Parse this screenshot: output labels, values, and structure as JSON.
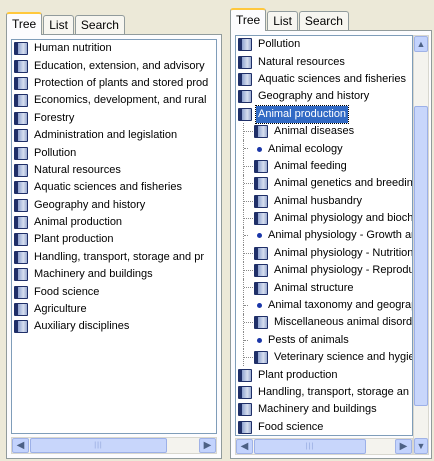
{
  "tabs": [
    "Tree",
    "List",
    "Search"
  ],
  "left_tree": [
    "Human nutrition",
    "Education, extension, and advisory",
    "Protection of plants and stored prod",
    "Economics, development, and rural",
    "Forestry",
    "Administration and legislation",
    "Pollution",
    "Natural resources",
    "Aquatic sciences and fisheries",
    "Geography and history",
    "Animal production",
    "Plant production",
    "Handling, transport, storage and pr",
    "Machinery and buildings",
    "Food science",
    "Agriculture",
    "Auxiliary disciplines"
  ],
  "right_tree": [
    {
      "label": "Pollution",
      "level": 0,
      "icon": "book-icon"
    },
    {
      "label": "Natural resources",
      "level": 0,
      "icon": "book-icon"
    },
    {
      "label": "Aquatic sciences and fisheries",
      "level": 0,
      "icon": "book-icon"
    },
    {
      "label": "Geography and history",
      "level": 0,
      "icon": "book-icon"
    },
    {
      "label": "Animal production",
      "level": 0,
      "icon": "book-icon",
      "selected": true
    },
    {
      "label": "Animal diseases",
      "level": 1,
      "icon": "book-icon"
    },
    {
      "label": "Animal ecology",
      "level": 1,
      "icon": "bullet-icon"
    },
    {
      "label": "Animal feeding",
      "level": 1,
      "icon": "book-icon"
    },
    {
      "label": "Animal genetics and breedin",
      "level": 1,
      "icon": "book-icon"
    },
    {
      "label": "Animal husbandry",
      "level": 1,
      "icon": "book-icon"
    },
    {
      "label": "Animal physiology and bioch",
      "level": 1,
      "icon": "book-icon"
    },
    {
      "label": "Animal physiology - Growth an",
      "level": 1,
      "icon": "bullet-icon"
    },
    {
      "label": "Animal physiology - Nutrition",
      "level": 1,
      "icon": "book-icon"
    },
    {
      "label": "Animal physiology - Reprodu",
      "level": 1,
      "icon": "book-icon"
    },
    {
      "label": "Animal structure",
      "level": 1,
      "icon": "book-icon"
    },
    {
      "label": "Animal taxonomy and geograp",
      "level": 1,
      "icon": "bullet-icon"
    },
    {
      "label": "Miscellaneous animal disorde",
      "level": 1,
      "icon": "book-icon"
    },
    {
      "label": "Pests of animals",
      "level": 1,
      "icon": "bullet-icon"
    },
    {
      "label": "Veterinary science and hygie",
      "level": 1,
      "icon": "book-icon"
    },
    {
      "label": "Plant production",
      "level": 0,
      "icon": "book-icon"
    },
    {
      "label": "Handling, transport, storage an",
      "level": 0,
      "icon": "book-icon"
    },
    {
      "label": "Machinery and buildings",
      "level": 0,
      "icon": "book-icon"
    },
    {
      "label": "Food science",
      "level": 0,
      "icon": "book-icon"
    }
  ],
  "colors": {
    "selection": "#316ac5",
    "tab_highlight": "#ffc83c"
  }
}
